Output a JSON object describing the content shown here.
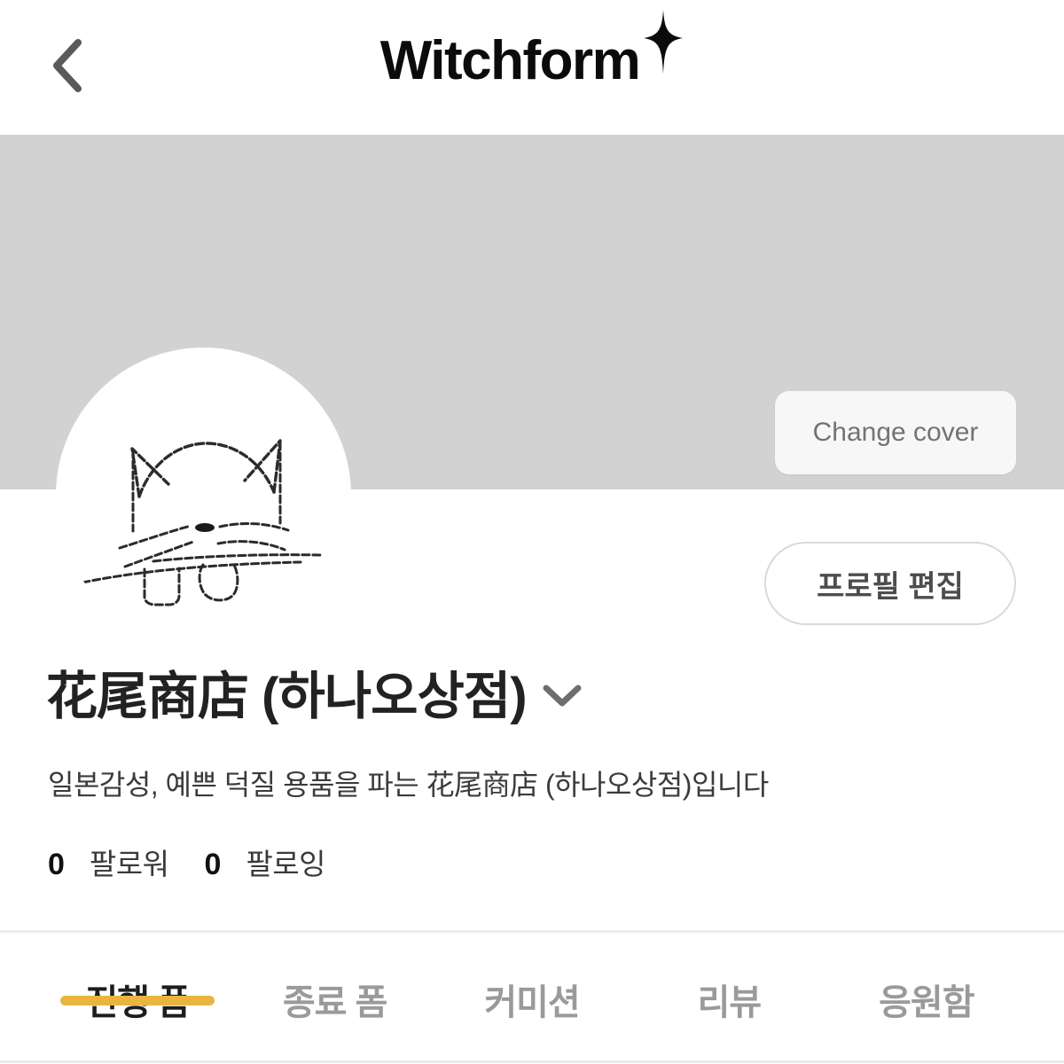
{
  "header": {
    "back_icon": "chevron-left-icon",
    "brand_name": "Witchform",
    "brand_sparkle_icon": "sparkle-icon"
  },
  "cover": {
    "change_cover_label": "Change cover",
    "background_color": "#d2d2d2"
  },
  "avatar": {
    "icon": "cat-sketch-avatar",
    "background_color": "#ffffff"
  },
  "actions": {
    "edit_profile_label": "프로필 편집"
  },
  "profile": {
    "shop_name": "花尾商店 (하나오상점)",
    "name_chevron_icon": "chevron-down-icon",
    "bio": "일본감성, 예쁜 덕질 용품을 파는 花尾商店 (하나오상점)입니다",
    "stats": [
      {
        "count": "0",
        "label": "팔로워"
      },
      {
        "count": "0",
        "label": "팔로잉"
      }
    ]
  },
  "tabs": {
    "active_index": 0,
    "active_color": "#e8b63f",
    "items": [
      {
        "label": "진행 폼"
      },
      {
        "label": "종료 폼"
      },
      {
        "label": "커미션"
      },
      {
        "label": "리뷰"
      },
      {
        "label": "응원함"
      }
    ]
  }
}
